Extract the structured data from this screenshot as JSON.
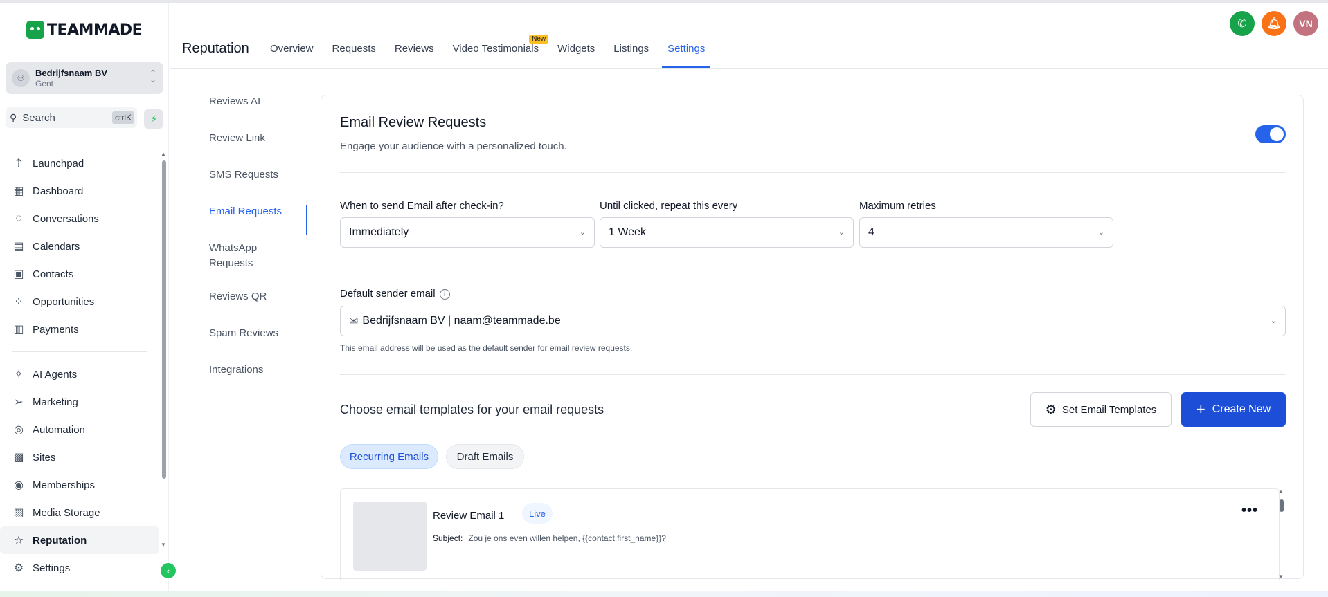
{
  "app": {
    "logo_text": "TEAMMADE"
  },
  "account": {
    "name": "Bedrijfsnaam BV",
    "location": "Gent"
  },
  "search": {
    "placeholder": "Search",
    "shortcut": "ctrlK"
  },
  "sidebar": {
    "items_top": [
      {
        "label": "Launchpad",
        "icon": "rocket-icon",
        "glyph": "⇡"
      },
      {
        "label": "Dashboard",
        "icon": "dashboard-icon",
        "glyph": "▦"
      },
      {
        "label": "Conversations",
        "icon": "chat-icon",
        "glyph": "◌"
      },
      {
        "label": "Calendars",
        "icon": "calendar-icon",
        "glyph": "▤"
      },
      {
        "label": "Contacts",
        "icon": "contacts-icon",
        "glyph": "▣"
      },
      {
        "label": "Opportunities",
        "icon": "opportunities-icon",
        "glyph": "⁘"
      },
      {
        "label": "Payments",
        "icon": "payments-icon",
        "glyph": "▥"
      }
    ],
    "items_bottom": [
      {
        "label": "AI Agents",
        "icon": "sparkle-icon",
        "glyph": "✧"
      },
      {
        "label": "Marketing",
        "icon": "send-icon",
        "glyph": "➢"
      },
      {
        "label": "Automation",
        "icon": "automation-icon",
        "glyph": "◎"
      },
      {
        "label": "Sites",
        "icon": "sites-icon",
        "glyph": "▩"
      },
      {
        "label": "Memberships",
        "icon": "memberships-icon",
        "glyph": "◉"
      },
      {
        "label": "Media Storage",
        "icon": "media-icon",
        "glyph": "▨"
      },
      {
        "label": "Reputation",
        "icon": "star-icon",
        "glyph": "☆"
      }
    ],
    "settings_label": "Settings"
  },
  "header": {
    "title": "Reputation",
    "tabs": [
      "Overview",
      "Requests",
      "Reviews",
      "Video Testimonials",
      "Widgets",
      "Listings",
      "Settings"
    ],
    "new_badge": "New",
    "user_initials": "VN"
  },
  "subnav": {
    "items": [
      "Reviews AI",
      "Review Link",
      "SMS Requests",
      "Email Requests",
      "WhatsApp Requests",
      "Reviews QR",
      "Spam Reviews",
      "Integrations"
    ],
    "active": "Email Requests"
  },
  "card": {
    "title": "Email Review Requests",
    "subtitle": "Engage your audience with a personalized touch.",
    "toggle_on": true,
    "when_label": "When to send Email after check-in?",
    "when_value": "Immediately",
    "repeat_label": "Until clicked, repeat this every",
    "repeat_value": "1 Week",
    "retries_label": "Maximum retries",
    "retries_value": "4",
    "sender_label": "Default sender email",
    "sender_value": "Bedrijfsnaam BV | naam@teammade.be",
    "sender_helper": "This email address will be used as the default sender for email review requests.",
    "templates_title": "Choose email templates for your email requests",
    "set_templates_label": "Set Email Templates",
    "create_new_label": "Create New",
    "chips": [
      "Recurring Emails",
      "Draft Emails"
    ],
    "email": {
      "name": "Review Email 1",
      "status": "Live",
      "subject_key": "Subject:",
      "subject_value": "Zou je ons even willen helpen, {{contact.first_name}}?"
    }
  },
  "colors": {
    "accent": "#2563eb",
    "brand": "#16a34a",
    "phone": "#16a34a",
    "bell": "#f97316",
    "avatar": "#c2737f"
  }
}
